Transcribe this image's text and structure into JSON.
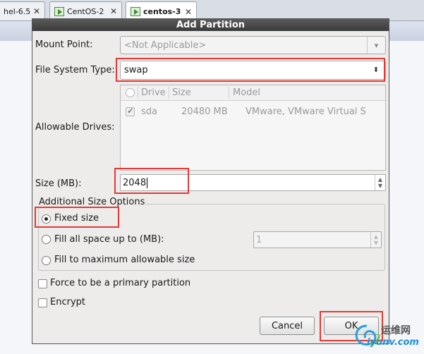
{
  "host_tabs": [
    {
      "label": "hel-6.5",
      "active": false
    },
    {
      "label": "CentOS-2",
      "active": false
    },
    {
      "label": "centos-3",
      "active": true
    }
  ],
  "dialog": {
    "title": "Add Partition",
    "mount_point": {
      "label": "Mount Point:",
      "value": "<Not Applicable>",
      "enabled": false
    },
    "file_system_type": {
      "label": "File System Type:",
      "value": "swap"
    },
    "allowable_drives": {
      "label": "Allowable Drives:",
      "columns": [
        "Drive",
        "Size",
        "Model"
      ],
      "rows": [
        {
          "checked": true,
          "drive": "sda",
          "size": "20480 MB",
          "model": "VMware, VMware Virtual S"
        }
      ]
    },
    "size": {
      "label": "Size (MB):",
      "value": "2048"
    },
    "additional_size_options": {
      "legend": "Additional Size Options",
      "fixed_size": {
        "label": "Fixed size",
        "selected": true
      },
      "fill_up_to": {
        "label": "Fill all space up to (MB):",
        "value": "1",
        "enabled": false
      },
      "fill_max": {
        "label": "Fill to maximum allowable size",
        "selected": false
      }
    },
    "force_primary": {
      "label": "Force to be a primary partition",
      "checked": false
    },
    "encrypt": {
      "label": "Encrypt",
      "checked": false
    },
    "buttons": {
      "cancel": "Cancel",
      "ok": "OK"
    }
  },
  "watermark": {
    "cn": "运维网",
    "url": "iyunv.com"
  },
  "colors": {
    "highlight": "#e53935",
    "titlebar": "#3a3a3a",
    "dialog_bg": "#edeceb"
  }
}
